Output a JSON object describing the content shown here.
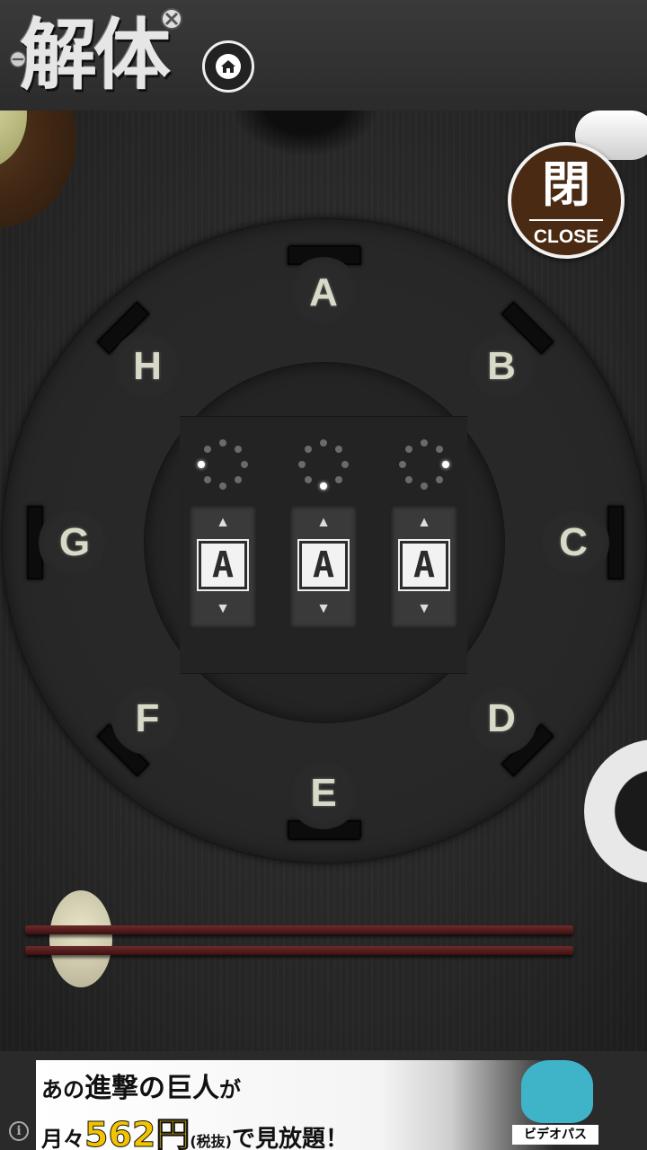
{
  "header": {
    "title": "解体",
    "home_icon": "home-icon"
  },
  "close_button": {
    "kanji": "閉",
    "label": "CLOSE"
  },
  "dial_letters": [
    "A",
    "B",
    "C",
    "D",
    "E",
    "F",
    "G",
    "H"
  ],
  "lock": {
    "wheels": [
      {
        "value": "A",
        "active_dot": 6,
        "up": "▲",
        "down": "▼"
      },
      {
        "value": "A",
        "active_dot": 4,
        "up": "▲",
        "down": "▼"
      },
      {
        "value": "A",
        "active_dot": 2,
        "up": "▲",
        "down": "▼"
      }
    ]
  },
  "ad": {
    "line1_prefix": "あの",
    "line1_title": "進撃の巨人",
    "line1_suffix": "が",
    "line2_prefix": "月々",
    "line2_price": "562円",
    "line2_tax": "(税抜)",
    "line2_suffix": "で見放題！",
    "brand": "ビデオパス",
    "info_icon": "i"
  },
  "colors": {
    "close_bg": "#4a2a12",
    "board_bg": "#262626",
    "price": "#f3c300"
  }
}
